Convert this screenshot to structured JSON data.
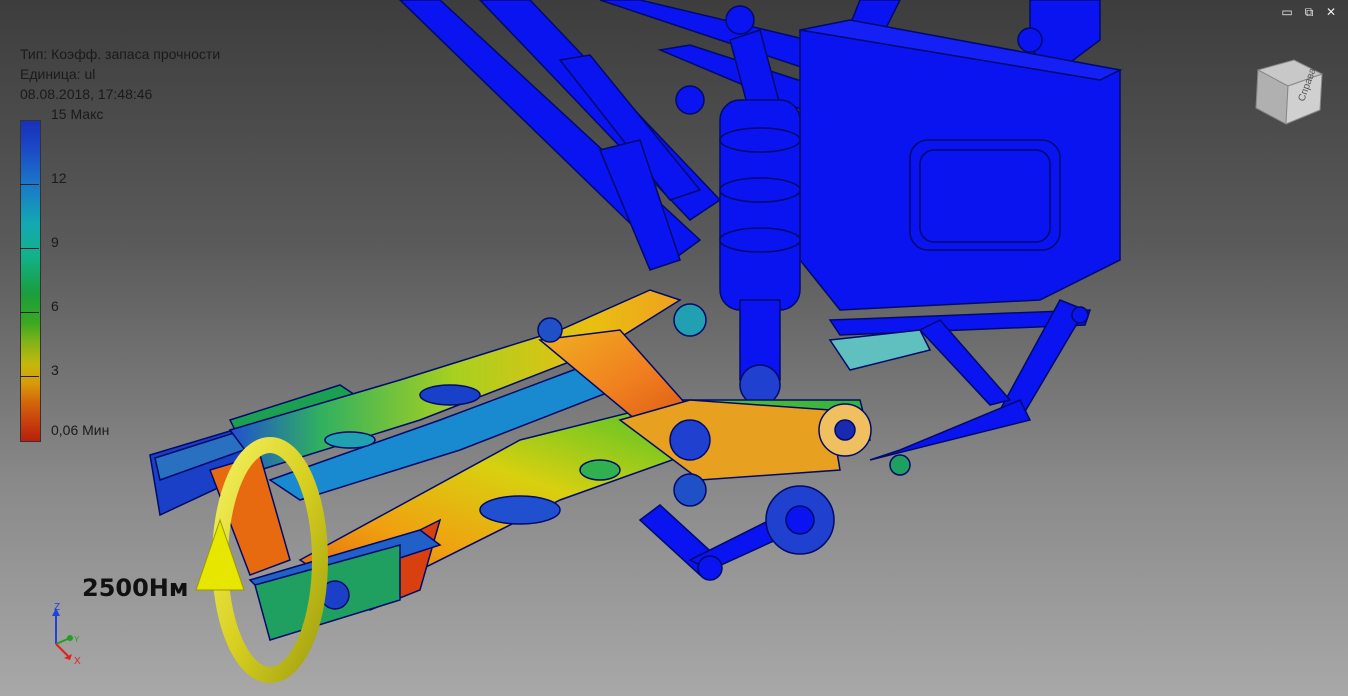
{
  "result_info": {
    "type_label": "Тип: Коэфф. запаса прочности",
    "unit_label": "Единица: ul",
    "timestamp": "08.08.2018, 17:48:46"
  },
  "legend": {
    "max_label": "15 Макс",
    "ticks": [
      "12",
      "9",
      "6",
      "3"
    ],
    "min_label": "0,06 Мин"
  },
  "load": {
    "torque_label": "2500Нм",
    "arrow_color": "#e6e600"
  },
  "viewcube": {
    "face_label": "Справа",
    "icon": "viewcube-icon"
  },
  "axis_triad": {
    "z_label": "Z",
    "y_label": "Y",
    "x_label": "X"
  },
  "window_controls": {
    "minimize": "▭",
    "restore": "⧉",
    "close": "✕"
  },
  "colors": {
    "frame": "#0a14f0",
    "safe": "#1830b8",
    "mid": "#1aa03a",
    "warn": "#e8c010",
    "critical": "#d8400c"
  }
}
